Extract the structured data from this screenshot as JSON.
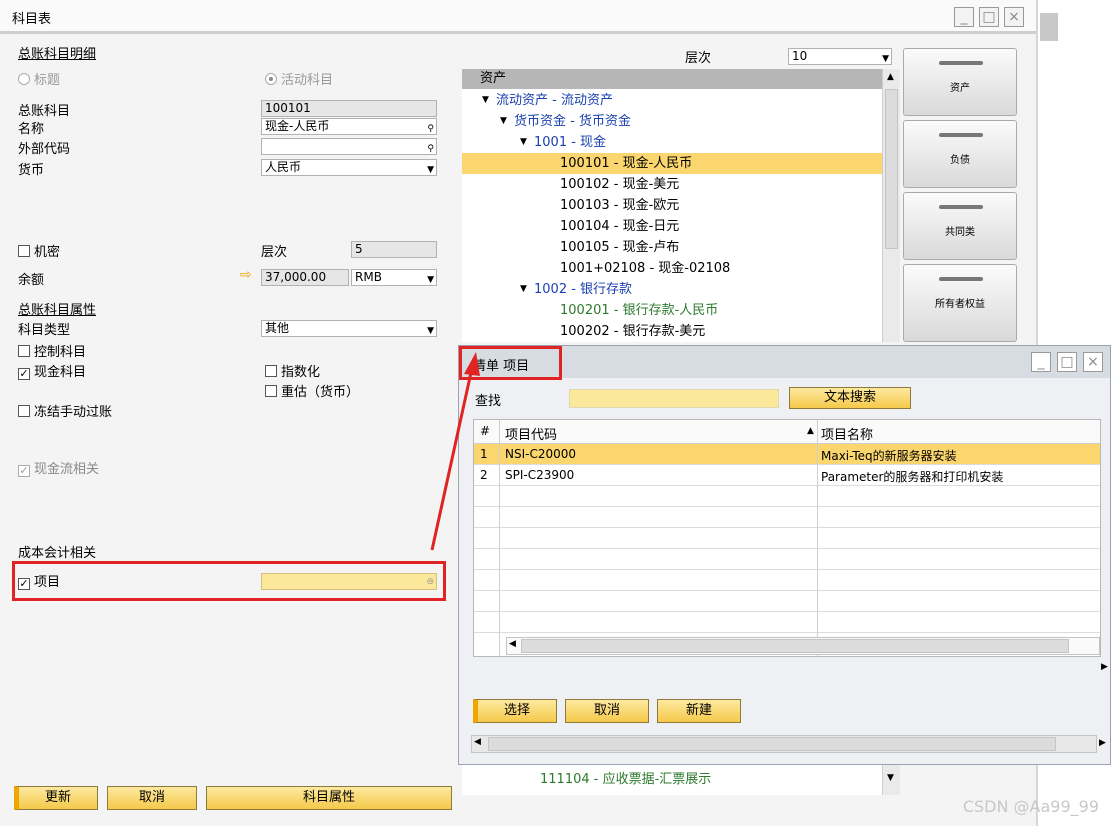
{
  "window": {
    "title": "科目表"
  },
  "left": {
    "section_title": "总账科目明细",
    "radio_title": "标题",
    "radio_active": "活动科目",
    "gl_account_label": "总账科目",
    "gl_account_value": "100101",
    "name_label": "名称",
    "name_value": "现金-人民币",
    "external_code_label": "外部代码",
    "external_code_value": "",
    "currency_label": "货币",
    "currency_value": "人民币",
    "confidential_label": "机密",
    "level_label": "层次",
    "level_value": "5",
    "balance_label": "余额",
    "balance_value": "37,000.00",
    "balance_currency": "RMB",
    "props_title": "总账科目属性",
    "account_type_label": "科目类型",
    "account_type_value": "其他",
    "control_account": "控制科目",
    "cash_account": "现金科目",
    "indexed": "指数化",
    "revaluation": "重估（货币）",
    "block_manual": "冻结手动过账",
    "cashflow": "现金流相关",
    "cost_title": "成本会计相关",
    "project_label": "项目",
    "buttons": {
      "update": "更新",
      "cancel": "取消",
      "properties": "科目属性"
    }
  },
  "tree": {
    "level_label": "层次",
    "level_value": "10",
    "header": "资产",
    "nodes": [
      {
        "text": "流动资产 - 流动资产",
        "indent": 0,
        "arrow": true,
        "color": "blue"
      },
      {
        "text": "货币资金 - 货币资金",
        "indent": 1,
        "arrow": true,
        "color": "blue"
      },
      {
        "text": "1001 - 现金",
        "indent": 2,
        "arrow": true,
        "color": "blue"
      },
      {
        "text": "100101 - 现金-人民币",
        "indent": 3,
        "arrow": false,
        "color": "black",
        "selected": true
      },
      {
        "text": "100102 - 现金-美元",
        "indent": 3,
        "arrow": false,
        "color": "black"
      },
      {
        "text": "100103 - 现金-欧元",
        "indent": 3,
        "arrow": false,
        "color": "black"
      },
      {
        "text": "100104 - 现金-日元",
        "indent": 3,
        "arrow": false,
        "color": "black"
      },
      {
        "text": "100105 - 现金-卢布",
        "indent": 3,
        "arrow": false,
        "color": "black"
      },
      {
        "text": "1001+02108 - 现金-02108",
        "indent": 3,
        "arrow": false,
        "color": "black"
      },
      {
        "text": "1002 - 银行存款",
        "indent": 2,
        "arrow": true,
        "color": "blue"
      },
      {
        "text": "100201 - 银行存款-人民币",
        "indent": 3,
        "arrow": false,
        "color": "green"
      },
      {
        "text": "100202 - 银行存款-美元",
        "indent": 3,
        "arrow": false,
        "color": "black"
      }
    ],
    "bottom_node": "111104 - 应收票据-汇票展示",
    "drawers": [
      "资产",
      "负债",
      "共同类",
      "所有者权益"
    ]
  },
  "dialog": {
    "title": "清单 项目",
    "search_label": "查找",
    "search_value": "",
    "text_search": "文本搜索",
    "columns": [
      "#",
      "项目代码",
      "项目名称"
    ],
    "rows": [
      {
        "num": "1",
        "code": "NSI-C20000",
        "name": "Maxi-Teq的新服务器安装"
      },
      {
        "num": "2",
        "code": "SPI-C23900",
        "name": "Parameter的服务器和打印机安装"
      }
    ],
    "buttons": {
      "choose": "选择",
      "cancel": "取消",
      "new": "新建"
    }
  },
  "watermark": "CSDN @Aa99_99",
  "colors": {
    "highlight": "#fbd66e",
    "button": "#f5c94a",
    "annotation_red": "#e02424",
    "tree_blue": "#1a3fb0",
    "tree_green": "#2d7a2d"
  }
}
